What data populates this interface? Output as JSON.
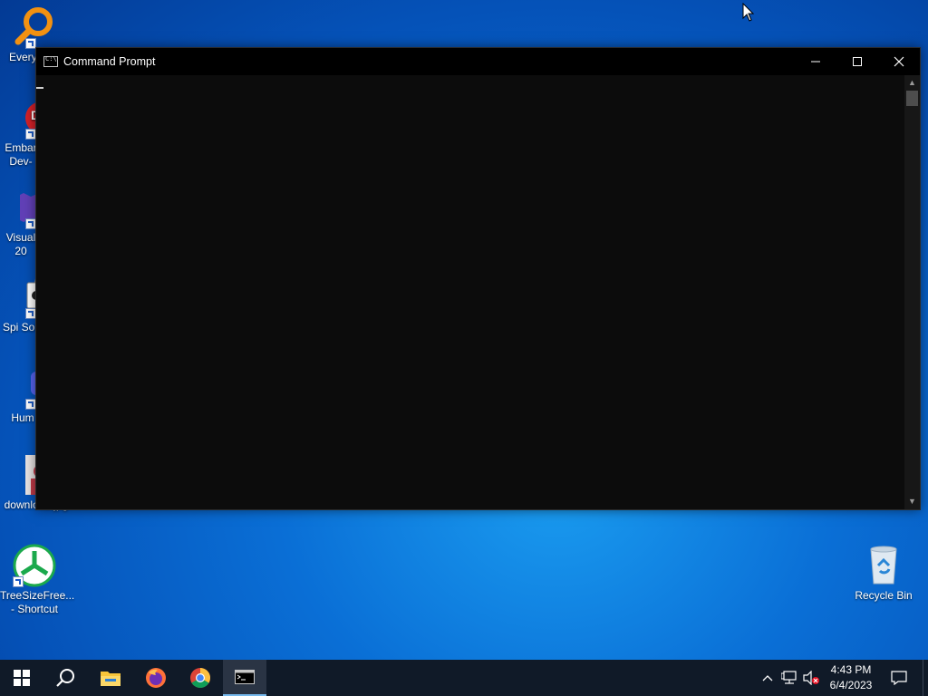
{
  "desktop": {
    "icons": [
      {
        "label": "Every",
        "icon": "everything-search-icon"
      },
      {
        "label": "Embar Dev-",
        "icon": "embarcadero-dev-cpp-icon"
      },
      {
        "label": "Visual 20",
        "icon": "visual-studio-icon"
      },
      {
        "label": "Spi Solit",
        "icon": "spider-solitaire-icon"
      },
      {
        "label": "Hum",
        "icon": "discord-icon"
      },
      {
        "label": "download.jpg",
        "icon": "image-file-icon"
      },
      {
        "label": "TreeSizeFree... - Shortcut",
        "icon": "treesize-icon"
      },
      {
        "label": "Recycle Bin",
        "icon": "recycle-bin-icon"
      }
    ]
  },
  "window": {
    "title": "Command Prompt",
    "icon": "cmd-icon",
    "controls": [
      "minimize-icon",
      "maximize-icon",
      "close-icon"
    ]
  },
  "taskbar": {
    "buttons": [
      "windows-start-icon",
      "search-icon",
      "file-explorer-icon",
      "firefox-icon",
      "chrome-icon",
      "command-prompt-icon"
    ],
    "tray": [
      "chevron-up-icon",
      "network-icon",
      "volume-muted-icon"
    ],
    "time": "4:43 PM",
    "date": "6/4/2023",
    "notification": "action-center-icon"
  },
  "colors": {
    "taskbar_bg": "#101a28",
    "console_bg": "#0c0c0c",
    "accent": "#76b9ed"
  }
}
